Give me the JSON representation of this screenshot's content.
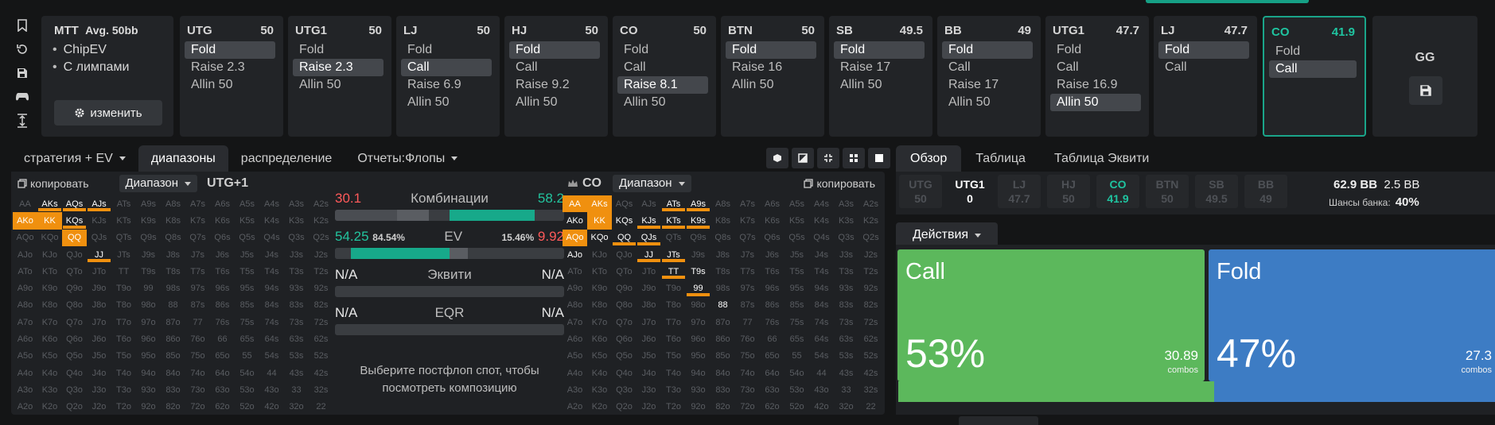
{
  "colors": {
    "accent": "#16a085",
    "call": "#5cb85c",
    "fold": "#3d7cc4",
    "raise": "#f0900f",
    "lose": "#ff5a5a"
  },
  "tools": [
    "bookmark-icon",
    "history-icon",
    "save-icon",
    "gamepad-icon",
    "fit-height-icon"
  ],
  "game": {
    "title": "MTT",
    "subtitle": "Avg. 50bb",
    "options": [
      "ChipEV",
      "С лимпами"
    ],
    "edit_label": "изменить"
  },
  "positions": [
    {
      "name": "UTG",
      "stack": "50",
      "actions": [
        {
          "label": "Fold",
          "sel": true
        },
        {
          "label": "Raise 2.3"
        },
        {
          "label": "Allin 50"
        }
      ]
    },
    {
      "name": "UTG1",
      "stack": "50",
      "actions": [
        {
          "label": "Fold"
        },
        {
          "label": "Raise 2.3",
          "sel": true
        },
        {
          "label": "Allin 50"
        }
      ]
    },
    {
      "name": "LJ",
      "stack": "50",
      "actions": [
        {
          "label": "Fold"
        },
        {
          "label": "Call",
          "sel": true
        },
        {
          "label": "Raise 6.9"
        },
        {
          "label": "Allin 50"
        }
      ]
    },
    {
      "name": "HJ",
      "stack": "50",
      "actions": [
        {
          "label": "Fold",
          "sel": true
        },
        {
          "label": "Call"
        },
        {
          "label": "Raise 9.2"
        },
        {
          "label": "Allin 50"
        }
      ]
    },
    {
      "name": "CO",
      "stack": "50",
      "actions": [
        {
          "label": "Fold"
        },
        {
          "label": "Call"
        },
        {
          "label": "Raise 8.1",
          "sel": true
        },
        {
          "label": "Allin 50"
        }
      ]
    },
    {
      "name": "BTN",
      "stack": "50",
      "actions": [
        {
          "label": "Fold",
          "sel": true
        },
        {
          "label": "Raise 16"
        },
        {
          "label": "Allin 50"
        }
      ]
    },
    {
      "name": "SB",
      "stack": "49.5",
      "actions": [
        {
          "label": "Fold",
          "sel": true
        },
        {
          "label": "Raise 17"
        },
        {
          "label": "Allin 50"
        }
      ]
    },
    {
      "name": "BB",
      "stack": "49",
      "actions": [
        {
          "label": "Fold",
          "sel": true
        },
        {
          "label": "Call"
        },
        {
          "label": "Raise 17"
        },
        {
          "label": "Allin 50"
        }
      ]
    },
    {
      "name": "UTG1",
      "stack": "47.7",
      "actions": [
        {
          "label": "Fold"
        },
        {
          "label": "Call"
        },
        {
          "label": "Raise 16.9"
        },
        {
          "label": "Allin 50",
          "sel": true
        }
      ]
    },
    {
      "name": "LJ",
      "stack": "47.7",
      "actions": [
        {
          "label": "Fold",
          "sel": true
        },
        {
          "label": "Call"
        }
      ]
    },
    {
      "name": "CO",
      "stack": "41.9",
      "active": true,
      "actions": [
        {
          "label": "Fold"
        },
        {
          "label": "Call",
          "sel": true
        }
      ]
    }
  ],
  "gg": {
    "label": "GG"
  },
  "left_tabs": [
    {
      "label": "стратегия + EV",
      "dropdown": true
    },
    {
      "label": "диапазоны",
      "sel": true
    },
    {
      "label": "распределение"
    },
    {
      "label": "Отчеты:Флопы",
      "dropdown": true
    }
  ],
  "view_tools": [
    "cube-icon",
    "contrast-icon",
    "compress-icon",
    "grid-icon",
    "square-icon"
  ],
  "ranges": {
    "left": {
      "copy_label": "копировать",
      "dropdown": "Диапазон",
      "position": "UTG+1"
    },
    "right": {
      "copy_label": "копировать",
      "dropdown": "Диапазон",
      "position": "CO"
    }
  },
  "hand_ranks": [
    "A",
    "K",
    "Q",
    "J",
    "T",
    "9",
    "8",
    "7",
    "6",
    "5",
    "4",
    "3",
    "2"
  ],
  "left_grid": {
    "full": [
      "AKo",
      "KK",
      "QQ"
    ],
    "partial": [
      "AKs",
      "AQs",
      "AJs",
      "KQs",
      "JJ"
    ]
  },
  "right_grid": {
    "full": [
      "AA",
      "AKs",
      "AQo",
      "KK"
    ],
    "partial": [
      "ATs",
      "A9s",
      "KJs",
      "KTs",
      "K9s",
      "QQ",
      "QJs",
      "JJ",
      "JTs",
      "TT",
      "99"
    ],
    "white": [
      "AKo",
      "KQo",
      "KQs",
      "T9s",
      "88",
      "AJo"
    ]
  },
  "stats": {
    "combos": {
      "label": "Комбинации",
      "left": "30.1",
      "right": "58.2"
    },
    "ev": {
      "label": "EV",
      "left": "54.25",
      "left_pct": "84.54%",
      "right_pct": "15.46%",
      "right": "9.92"
    },
    "equity": {
      "label": "Эквити",
      "left": "N/A",
      "right": "N/A"
    },
    "eqr": {
      "label": "EQR",
      "left": "N/A",
      "right": "N/A"
    },
    "hint": "Выберите постфлоп спот, чтобы посмотреть композицию"
  },
  "right_tabs": [
    {
      "label": "Обзор",
      "sel": true
    },
    {
      "label": "Таблица"
    },
    {
      "label": "Таблица Эквити"
    }
  ],
  "overview": {
    "positions": [
      {
        "name": "UTG",
        "stack": "50"
      },
      {
        "name": "UTG1",
        "stack": "0",
        "cur": true
      },
      {
        "name": "LJ",
        "stack": "47.7"
      },
      {
        "name": "HJ",
        "stack": "50"
      },
      {
        "name": "CO",
        "stack": "41.9",
        "act": true
      },
      {
        "name": "BTN",
        "stack": "50"
      },
      {
        "name": "SB",
        "stack": "49.5"
      },
      {
        "name": "BB",
        "stack": "49"
      }
    ],
    "pot": "62.9 BB",
    "to_call": "2.5 BB",
    "pot_odds_label": "Шансы банка:",
    "pot_odds": "40%"
  },
  "actions": {
    "dropdown_label": "Действия",
    "items": [
      {
        "name": "Call",
        "percent": "53%",
        "share": 0.53,
        "combos": "30.89",
        "combos_label": "combos"
      },
      {
        "name": "Fold",
        "percent": "47%",
        "share": 0.47,
        "combos": "27.3",
        "combos_label": "combos"
      }
    ]
  }
}
